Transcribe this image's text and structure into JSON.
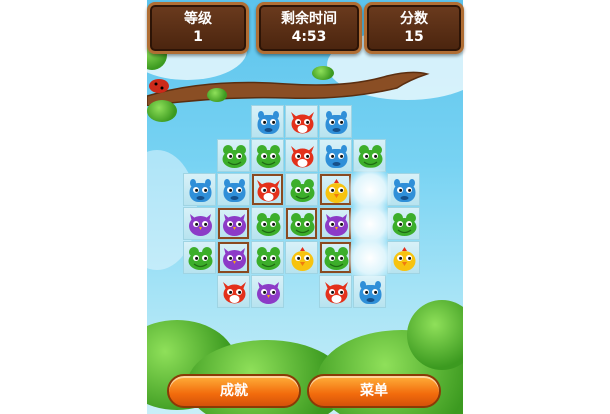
{
  "hud": {
    "level": {
      "label": "等级",
      "value": "1"
    },
    "time": {
      "label": "剩余时间",
      "value": "4:53"
    },
    "score": {
      "label": "分数",
      "value": "15"
    }
  },
  "buttons": {
    "achievements": "成就",
    "menu": "菜单"
  },
  "colors": {
    "blue": "#2f8fd8",
    "red": "#e3311b",
    "green": "#3cae2a",
    "yellow": "#f7c30f",
    "purple": "#8c3bc7"
  },
  "board": {
    "rows": [
      [
        null,
        null,
        "blue",
        "red",
        "blue",
        null,
        null
      ],
      [
        null,
        "green",
        "green",
        "red",
        "blue",
        "green",
        null
      ],
      [
        "blue",
        "blue",
        "red",
        "green",
        "yellow",
        null,
        "blue"
      ],
      [
        "purple",
        "purple",
        "green",
        "green",
        "purple",
        null,
        "green"
      ],
      [
        "green",
        "purple",
        "green",
        "yellow",
        "green",
        null,
        "yellow"
      ],
      [
        null,
        "red",
        "purple",
        null,
        "red",
        "blue",
        null
      ]
    ],
    "wood_cells": [
      [
        2,
        2
      ],
      [
        3,
        1
      ],
      [
        3,
        3
      ],
      [
        3,
        4
      ],
      [
        4,
        1
      ],
      [
        4,
        4
      ],
      [
        2,
        4
      ]
    ],
    "ice_column": 5
  }
}
